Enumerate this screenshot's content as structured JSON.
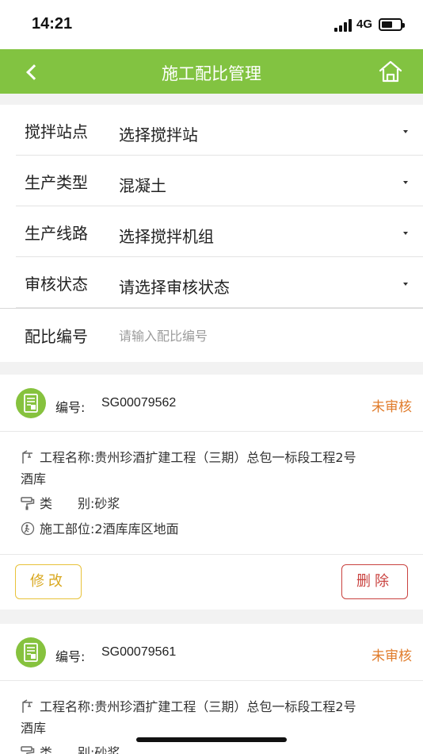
{
  "status_bar": {
    "time": "14:21",
    "network": "4G"
  },
  "nav": {
    "title": "施工配比管理",
    "back_icon": "chevron-left-icon",
    "home_icon": "home-icon",
    "color": "#82c341"
  },
  "filters": [
    {
      "label": "搅拌站点",
      "value": "选择搅拌站"
    },
    {
      "label": "生产类型",
      "value": "混凝土"
    },
    {
      "label": "生产线路",
      "value": "选择搅拌机组"
    },
    {
      "label": "审核状态",
      "value": "请选择审核状态"
    }
  ],
  "search": {
    "label": "配比编号",
    "placeholder": "请输入配比编号",
    "value": ""
  },
  "cards": [
    {
      "no_label": "编号:",
      "no": "SG00079562",
      "status": "未审核",
      "project_label": "工程名称:",
      "project": "贵州珍酒扩建工程（三期）总包一标段工程2号",
      "project_cont": "酒库",
      "type_label": "类　　别:",
      "type": "砂浆",
      "part_label": "施工部位:",
      "part": "2酒库库区地面",
      "edit_label": "修改",
      "delete_label": "删除"
    },
    {
      "no_label": "编号:",
      "no": "SG00079561",
      "status": "未审核",
      "project_label": "工程名称:",
      "project": "贵州珍酒扩建工程（三期）总包一标段工程2号",
      "project_cont": "酒库",
      "type_label": "类　　别:",
      "type": "砂浆"
    }
  ],
  "colors": {
    "accent": "#82c341",
    "status": "#e07b2a",
    "edit": "#d9a820",
    "delete": "#c9423f"
  }
}
